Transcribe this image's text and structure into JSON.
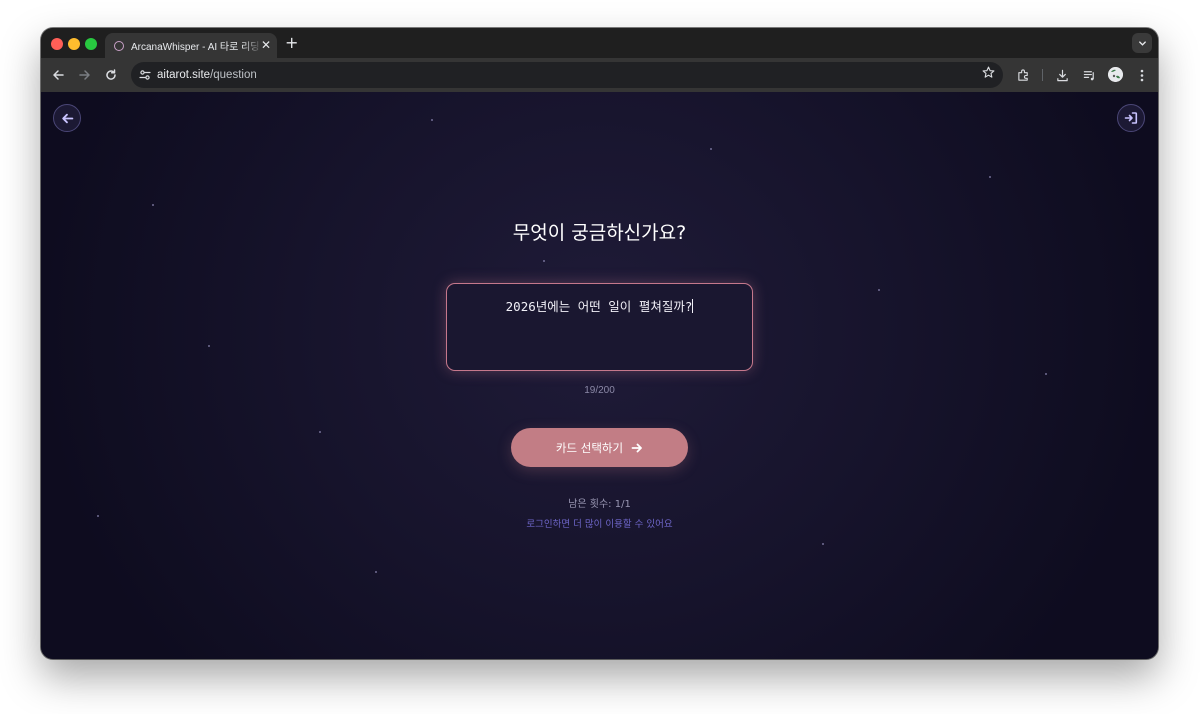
{
  "browser": {
    "tab_title": "ArcanaWhisper - AI 타로 리딩",
    "tab_close": "✕",
    "new_tab": "+",
    "url_domain": "aitarot.site",
    "url_path": "/question"
  },
  "page": {
    "heading": "무엇이 궁금하신가요?",
    "question_value": "2026년에는 어떤 일이 펼쳐질까?",
    "char_count": "19/200",
    "cta_label": "카드 선택하기",
    "remaining_label": "남은 횟수: 1/1",
    "login_hint": "로그인하면 더 많이 이용할 수 있어요"
  },
  "icons": {
    "back": "arrow-left-icon",
    "login": "login-icon",
    "cta_arrow": "arrow-right-icon"
  },
  "colors": {
    "background": "#16132b",
    "accent": "#c27d85",
    "input_border": "#c5788c",
    "link": "#6e66c9"
  }
}
